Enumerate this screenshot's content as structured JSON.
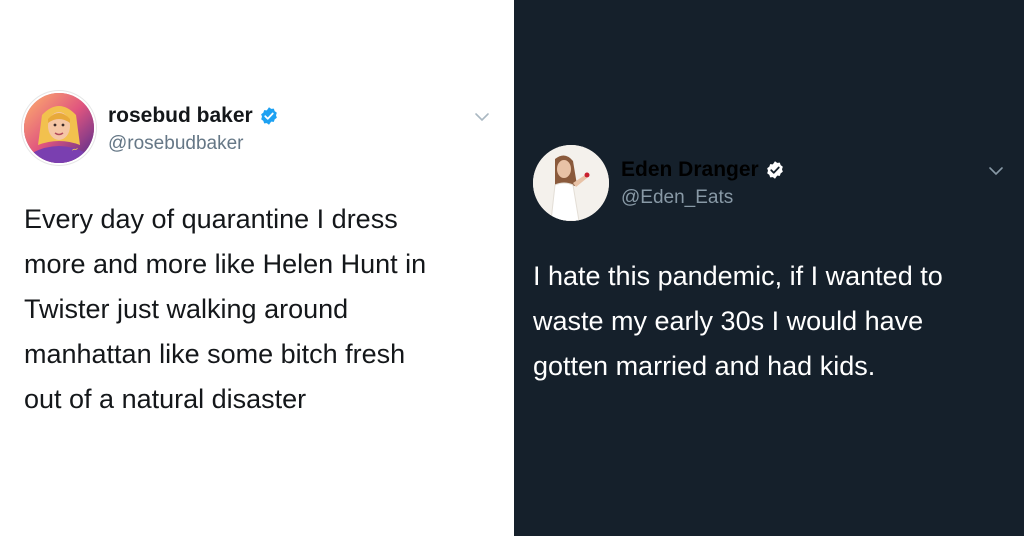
{
  "left_tweet": {
    "display_name": "rosebud baker",
    "handle": "@rosebudbaker",
    "verified": true,
    "verified_color": "#1da1f2",
    "text_lines": [
      "Every day of quarantine I dress",
      "more and more like Helen Hunt in",
      "Twister just walking around",
      "manhattan like some bitch fresh",
      "out of a natural disaster"
    ],
    "theme": "light",
    "background": "#ffffff"
  },
  "right_tweet": {
    "display_name": "Eden Dranger",
    "handle": "@Eden_Eats",
    "verified": true,
    "verified_color": "#ffffff",
    "text_lines": [
      "I hate this pandemic, if I wanted to",
      "waste my early 30s I would have",
      "gotten married and had kids."
    ],
    "theme": "dark",
    "background": "#15202b"
  },
  "icons": {
    "verified": "verified-badge-icon",
    "menu": "chevron-down-icon"
  }
}
